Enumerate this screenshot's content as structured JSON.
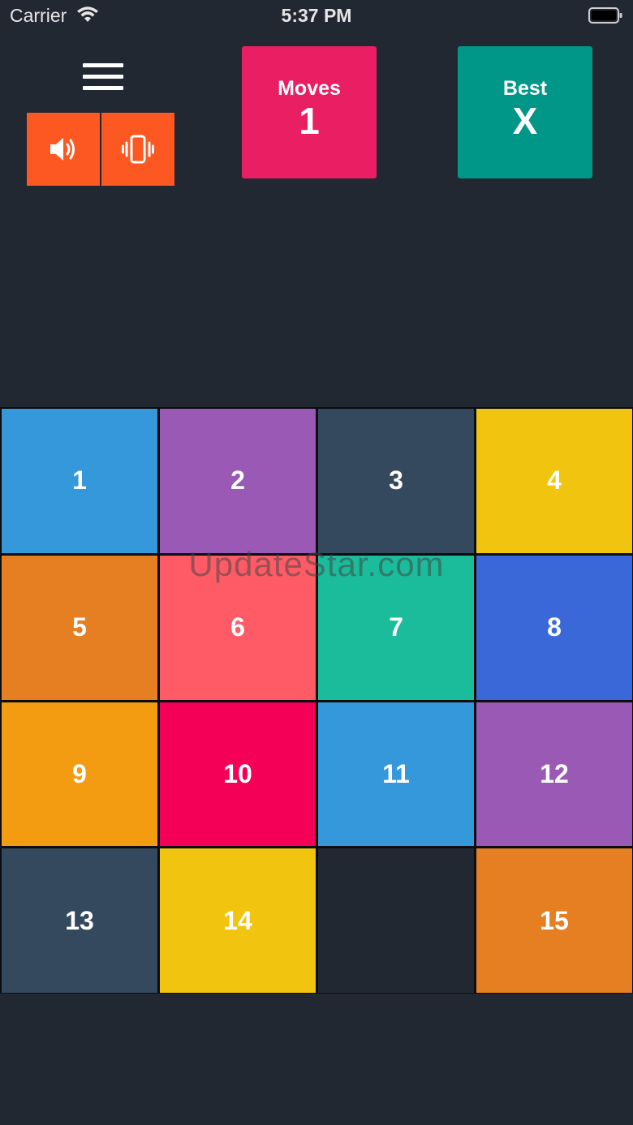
{
  "status_bar": {
    "carrier": "Carrier",
    "time": "5:37 PM"
  },
  "controls": {
    "menu_icon": "hamburger-menu-icon",
    "sound_icon": "speaker-icon",
    "vibration_icon": "vibration-icon",
    "toggle_color": "#fd5722"
  },
  "moves": {
    "label": "Moves",
    "value": "1",
    "color": "#e91e63"
  },
  "best": {
    "label": "Best",
    "value": "X",
    "color": "#009688"
  },
  "board": {
    "rows": 4,
    "cols": 4,
    "tiles": [
      {
        "number": "1",
        "color": "#3498db"
      },
      {
        "number": "2",
        "color": "#9b59b6"
      },
      {
        "number": "3",
        "color": "#34495e"
      },
      {
        "number": "4",
        "color": "#f1c40f"
      },
      {
        "number": "5",
        "color": "#e67e22"
      },
      {
        "number": "6",
        "color": "#ff5b66"
      },
      {
        "number": "7",
        "color": "#1abc9c"
      },
      {
        "number": "8",
        "color": "#3b68d8"
      },
      {
        "number": "9",
        "color": "#f39c12"
      },
      {
        "number": "10",
        "color": "#f50057"
      },
      {
        "number": "11",
        "color": "#3498db"
      },
      {
        "number": "12",
        "color": "#9b59b6"
      },
      {
        "number": "13",
        "color": "#34495e"
      },
      {
        "number": "14",
        "color": "#f1c40f"
      },
      {
        "number": "",
        "color": "#222831"
      },
      {
        "number": "15",
        "color": "#e67e22"
      }
    ]
  },
  "watermark": "UpdateStar.com"
}
